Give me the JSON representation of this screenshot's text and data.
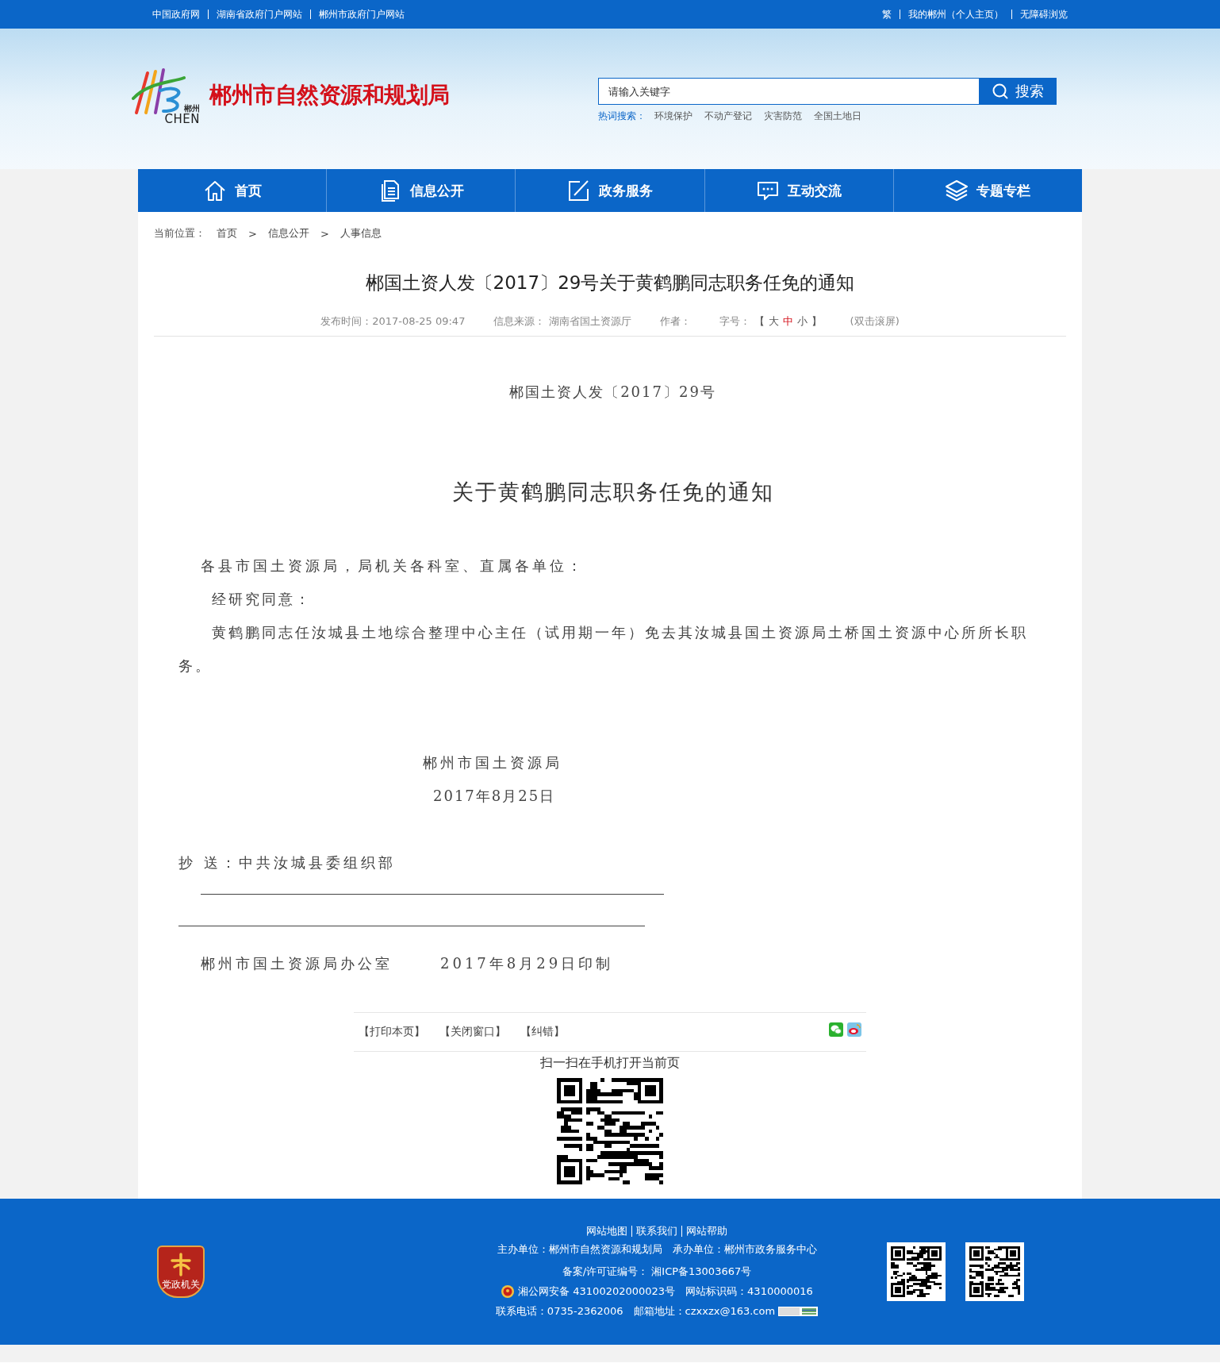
{
  "top_bar": {
    "left_links": [
      "中国政府网",
      "湖南省政府门户网站",
      "郴州市政府门户网站"
    ],
    "right_links": [
      "繁",
      "我的郴州（个人主页）",
      "无障碍浏览"
    ]
  },
  "header": {
    "logo": {
      "small": "郴州",
      "latin": "CHEN"
    },
    "site_name": "郴州市自然资源和规划局",
    "search": {
      "placeholder": "请输入关键字",
      "button": "搜索"
    },
    "hot_search": {
      "label": "热词搜索：",
      "terms": [
        "环境保护",
        "不动产登记",
        "灾害防范",
        "全国土地日"
      ]
    }
  },
  "nav": [
    {
      "label": "首页",
      "kind": "home"
    },
    {
      "label": "信息公开",
      "kind": "document"
    },
    {
      "label": "政务服务",
      "kind": "edit"
    },
    {
      "label": "互动交流",
      "kind": "chat"
    },
    {
      "label": "专题专栏",
      "kind": "layers"
    }
  ],
  "breadcrumb": {
    "label": "当前位置：",
    "separator": ">",
    "items": [
      "首页",
      "信息公开",
      "人事信息"
    ]
  },
  "article": {
    "title": "郴国土资人发〔2017〕29号关于黄鹤鹏同志职务任免的通知",
    "meta": {
      "published": "发布时间：2017-08-25 09:47",
      "source": "信息来源： 湖南省国土资源厅",
      "author": "作者：",
      "font_size": {
        "label": "字号：",
        "open": "【",
        "close": "】",
        "options": [
          {
            "label": "大",
            "selected": false
          },
          {
            "label": "中",
            "selected": true
          },
          {
            "label": "小",
            "selected": false
          }
        ]
      },
      "fullscreen": "(双击滚屏)"
    },
    "doc_number": "郴国土资人发〔2017〕29号",
    "heading": "关于黄鹤鹏同志职务任免的通知",
    "salutation": "各县市国土资源局，局机关各科室、直属各单位：",
    "paragraphs": [
      "经研究同意：",
      "黄鹤鹏同志任汝城县土地综合整理中心主任（试用期一年）免去其汝城县国土资源局土桥国土资源中心所所长职务。"
    ],
    "signature": {
      "org": "郴州市国土资源局",
      "date": "2017年8月25日"
    },
    "cc": "抄 送：中共汝城县委组织部",
    "issuer": {
      "office": "郴州市国土资源局办公室",
      "date": "2017年8月29日印制"
    }
  },
  "actions": [
    "【打印本页】",
    "【关闭窗口】",
    "【纠错】"
  ],
  "scan_label": "扫一扫在手机打开当前页",
  "footer": {
    "links": [
      "网站地图",
      "联系我们",
      "网站帮助"
    ],
    "emblem": "党政机关",
    "sponsor": "主办单位：郴州市自然资源和规划局　承办单位：郴州市政务服务中心",
    "record": "备案/许可证编号： 湘ICP备13003667号",
    "police": "湘公网安备 43100202000023号　网站标识码：4310000016",
    "contact": "联系电话：0735-2362006　邮箱地址：czxxzx@163.com"
  }
}
